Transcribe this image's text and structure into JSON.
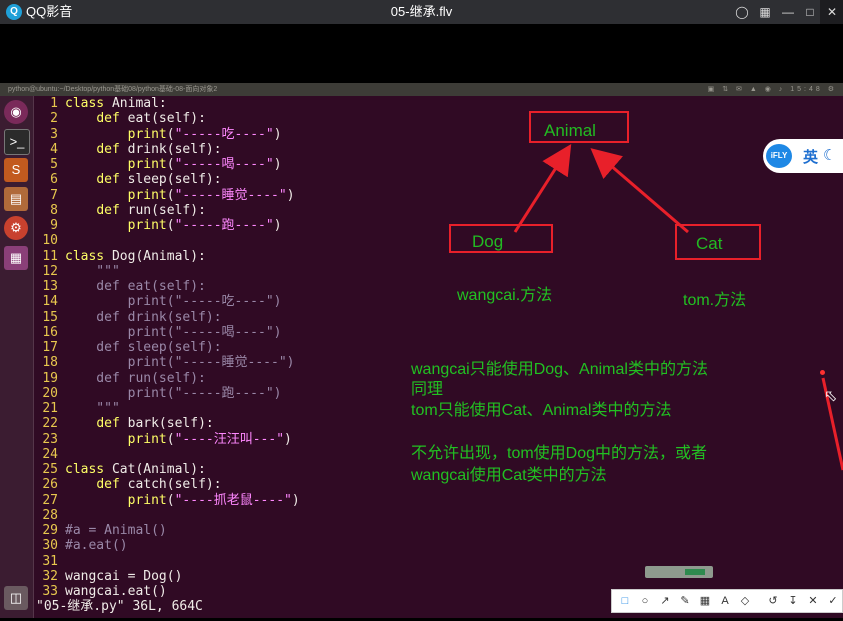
{
  "player": {
    "app_name": "QQ影音",
    "file_title": "05-继承.flv"
  },
  "desktop": {
    "path_text": "python@ubuntu:~/Desktop/python基础08/python基础-08-面向对象2",
    "clock": "15:48"
  },
  "launcher_icons": [
    "ubuntu-icon",
    "terminal-icon",
    "sublime-icon",
    "files-icon",
    "settings-icon",
    "workspace-icon"
  ],
  "code_lines": [
    {
      "n": "1",
      "t": "class Animal:"
    },
    {
      "n": "2",
      "t": "    def eat(self):"
    },
    {
      "n": "3",
      "t": "        print(\"-----吃----\")"
    },
    {
      "n": "4",
      "t": "    def drink(self):"
    },
    {
      "n": "5",
      "t": "        print(\"-----喝----\")"
    },
    {
      "n": "6",
      "t": "    def sleep(self):"
    },
    {
      "n": "7",
      "t": "        print(\"-----睡觉----\")"
    },
    {
      "n": "8",
      "t": "    def run(self):"
    },
    {
      "n": "9",
      "t": "        print(\"-----跑----\")"
    },
    {
      "n": "10",
      "t": ""
    },
    {
      "n": "11",
      "t": "class Dog(Animal):"
    },
    {
      "n": "12",
      "t": "    \"\"\""
    },
    {
      "n": "13",
      "t": "    def eat(self):"
    },
    {
      "n": "14",
      "t": "        print(\"-----吃----\")"
    },
    {
      "n": "15",
      "t": "    def drink(self):"
    },
    {
      "n": "16",
      "t": "        print(\"-----喝----\")"
    },
    {
      "n": "17",
      "t": "    def sleep(self):"
    },
    {
      "n": "18",
      "t": "        print(\"-----睡觉----\")"
    },
    {
      "n": "19",
      "t": "    def run(self):"
    },
    {
      "n": "20",
      "t": "        print(\"-----跑----\")"
    },
    {
      "n": "21",
      "t": "    \"\"\""
    },
    {
      "n": "22",
      "t": "    def bark(self):"
    },
    {
      "n": "23",
      "t": "        print(\"----汪汪叫---\")"
    },
    {
      "n": "24",
      "t": ""
    },
    {
      "n": "25",
      "t": "class Cat(Animal):"
    },
    {
      "n": "26",
      "t": "    def catch(self):"
    },
    {
      "n": "27",
      "t": "        print(\"----抓老鼠----\")"
    },
    {
      "n": "28",
      "t": ""
    },
    {
      "n": "29",
      "t": "#a = Animal()"
    },
    {
      "n": "30",
      "t": "#a.eat()"
    },
    {
      "n": "31",
      "t": ""
    },
    {
      "n": "32",
      "t": "wangcai = Dog()"
    },
    {
      "n": "33",
      "t": "wangcai.eat()"
    }
  ],
  "status_line": "\"05-继承.py\" 36L, 664C",
  "diagram": {
    "animal": "Animal",
    "dog": "Dog",
    "cat": "Cat",
    "dog_methods": "wangcai.方法",
    "cat_methods": "tom.方法"
  },
  "notes": {
    "line1": "wangcai只能使用Dog、Animal类中的方法",
    "line2": "同理",
    "line3": "tom只能使用Cat、Animal类中的方法",
    "line4": "不允许出现，tom使用Dog中的方法，或者",
    "line5": "wangcai使用Cat类中的方法"
  },
  "ifly": {
    "logo": "iFLY",
    "lang": "英"
  },
  "colors": {
    "terminal_bg": "#300a24",
    "line_number": "#e8c84e",
    "keyword": "#ffff66",
    "string": "#ff88ff",
    "annotation_green": "#22c022",
    "annotation_red": "#e8202a"
  }
}
